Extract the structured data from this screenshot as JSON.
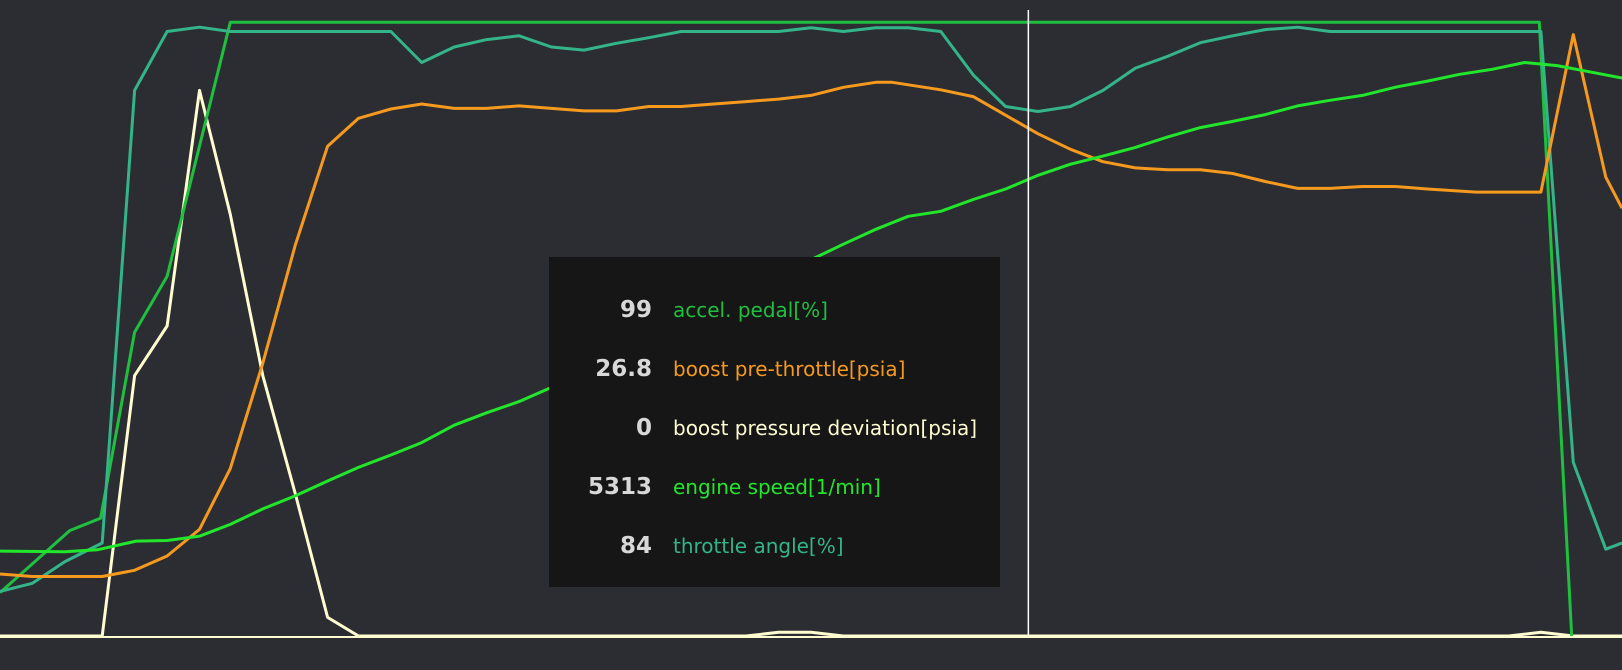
{
  "colors": {
    "background": "#2c2d32",
    "cursor": "#ffffff",
    "baseline": "#fffdd0",
    "tooltip_bg": "#161617"
  },
  "tooltip": {
    "rows": [
      {
        "value": "99",
        "label": "accel. pedal[%]",
        "color": "#1fbf3f"
      },
      {
        "value": "26.8",
        "label": "boost pre-throttle[psia]",
        "color": "#f59a1e"
      },
      {
        "value": "0",
        "label": "boost pressure deviation[psia]",
        "color": "#fffdd0"
      },
      {
        "value": "5313",
        "label": "engine speed[1/min]",
        "color": "#22e62b"
      },
      {
        "value": "84",
        "label": "throttle angle[%]",
        "color": "#34b489"
      }
    ]
  },
  "chart_data": {
    "type": "line",
    "xlim": [
      0,
      100
    ],
    "ylim": [
      0,
      100
    ],
    "cursor_x": 63.4,
    "grid": false,
    "legend": "none",
    "series": [
      {
        "name": "accel. pedal[%]",
        "color": "#1fbf3f",
        "points": [
          [
            0,
            7
          ],
          [
            4.3,
            17
          ],
          [
            6.2,
            19
          ],
          [
            8.3,
            49
          ],
          [
            10.3,
            58
          ],
          [
            14.2,
            99
          ],
          [
            94.9,
            99
          ],
          [
            96.9,
            0
          ]
        ]
      },
      {
        "name": "boost pre-throttle[psia]",
        "color": "#f59a1e",
        "points": [
          [
            0,
            10
          ],
          [
            2,
            9.6
          ],
          [
            6.3,
            9.6
          ],
          [
            8.3,
            10.6
          ],
          [
            10.3,
            12.9
          ],
          [
            12.3,
            17.2
          ],
          [
            14.2,
            27
          ],
          [
            16.2,
            44
          ],
          [
            18.2,
            63
          ],
          [
            20.2,
            79
          ],
          [
            22.1,
            83.5
          ],
          [
            24.1,
            85
          ],
          [
            26,
            85.8
          ],
          [
            28,
            85.1
          ],
          [
            30,
            85.1
          ],
          [
            32,
            85.5
          ],
          [
            34,
            85.1
          ],
          [
            36,
            84.7
          ],
          [
            38,
            84.7
          ],
          [
            40,
            85.4
          ],
          [
            42,
            85.4
          ],
          [
            44,
            85.8
          ],
          [
            46,
            86.2
          ],
          [
            48,
            86.6
          ],
          [
            50,
            87.2
          ],
          [
            52,
            88.5
          ],
          [
            54,
            89.3
          ],
          [
            55,
            89.3
          ],
          [
            57,
            88.5
          ],
          [
            58,
            88.1
          ],
          [
            60,
            87
          ],
          [
            62,
            84
          ],
          [
            64,
            81
          ],
          [
            66,
            78.5
          ],
          [
            68,
            76.5
          ],
          [
            70,
            75.5
          ],
          [
            72,
            75.2
          ],
          [
            74,
            75.2
          ],
          [
            76,
            74.6
          ],
          [
            78,
            73.3
          ],
          [
            80,
            72.2
          ],
          [
            82,
            72.2
          ],
          [
            84,
            72.5
          ],
          [
            86,
            72.5
          ],
          [
            88,
            72.1
          ],
          [
            91,
            71.6
          ],
          [
            93,
            71.6
          ],
          [
            95,
            71.6
          ],
          [
            97,
            97
          ],
          [
            99,
            74
          ],
          [
            100,
            69
          ]
        ]
      },
      {
        "name": "boost pressure deviation[psia]",
        "color": "#fffdd0",
        "points": [
          [
            0,
            0
          ],
          [
            6.3,
            0
          ],
          [
            8.3,
            42
          ],
          [
            10.3,
            50
          ],
          [
            12.3,
            88
          ],
          [
            14.2,
            68
          ],
          [
            16.2,
            42
          ],
          [
            18.2,
            23
          ],
          [
            20.2,
            3
          ],
          [
            22.1,
            0
          ],
          [
            46,
            0
          ],
          [
            48,
            0.6
          ],
          [
            50,
            0.6
          ],
          [
            52,
            0
          ],
          [
            93,
            0
          ],
          [
            95,
            0.6
          ],
          [
            97,
            0
          ],
          [
            100,
            0
          ]
        ]
      },
      {
        "name": "engine speed[1/min]",
        "color": "#22e62b",
        "points": [
          [
            0,
            13.7
          ],
          [
            4,
            13.6
          ],
          [
            6,
            13.9
          ],
          [
            8.4,
            15.3
          ],
          [
            10.3,
            15.4
          ],
          [
            12.3,
            16.1
          ],
          [
            14.2,
            18
          ],
          [
            16.2,
            20.5
          ],
          [
            18.2,
            22.6
          ],
          [
            20.2,
            25
          ],
          [
            22.1,
            27.2
          ],
          [
            24.1,
            29.2
          ],
          [
            26,
            31.2
          ],
          [
            28,
            34
          ],
          [
            30,
            36
          ],
          [
            32,
            37.8
          ],
          [
            34,
            40.1
          ],
          [
            36,
            43
          ],
          [
            38,
            45.5
          ],
          [
            40,
            48
          ],
          [
            42,
            50.5
          ],
          [
            44,
            53.1
          ],
          [
            46,
            55.6
          ],
          [
            48,
            58.2
          ],
          [
            50,
            60.7
          ],
          [
            52,
            63.2
          ],
          [
            54,
            65.6
          ],
          [
            56,
            67.7
          ],
          [
            58,
            68.5
          ],
          [
            60,
            70.4
          ],
          [
            62,
            72.1
          ],
          [
            64,
            74.3
          ],
          [
            66,
            76.1
          ],
          [
            68,
            77.4
          ],
          [
            70,
            78.8
          ],
          [
            72,
            80.5
          ],
          [
            74,
            82
          ],
          [
            76,
            83
          ],
          [
            78,
            84.1
          ],
          [
            80,
            85.5
          ],
          [
            82,
            86.4
          ],
          [
            84,
            87.2
          ],
          [
            86,
            88.5
          ],
          [
            88,
            89.5
          ],
          [
            90,
            90.6
          ],
          [
            92,
            91.4
          ],
          [
            94,
            92.5
          ],
          [
            96,
            92
          ],
          [
            98,
            91
          ],
          [
            100,
            90
          ]
        ]
      },
      {
        "name": "throttle angle[%]",
        "color": "#34b489",
        "points": [
          [
            0,
            7.2
          ],
          [
            2,
            8.5
          ],
          [
            4,
            12
          ],
          [
            6.3,
            15
          ],
          [
            8.3,
            88
          ],
          [
            10.3,
            97.5
          ],
          [
            12.3,
            98.2
          ],
          [
            14.2,
            97.5
          ],
          [
            22.1,
            97.5
          ],
          [
            24.1,
            97.5
          ],
          [
            26,
            92.5
          ],
          [
            28,
            95
          ],
          [
            30,
            96.2
          ],
          [
            32,
            96.8
          ],
          [
            34,
            95
          ],
          [
            36,
            94.5
          ],
          [
            38,
            95.6
          ],
          [
            40,
            96.5
          ],
          [
            42,
            97.5
          ],
          [
            46,
            97.5
          ],
          [
            48,
            97.5
          ],
          [
            50,
            98.1
          ],
          [
            52,
            97.5
          ],
          [
            54,
            98.1
          ],
          [
            56,
            98.1
          ],
          [
            58,
            97.5
          ],
          [
            60,
            90.5
          ],
          [
            62,
            85.4
          ],
          [
            64,
            84.6
          ],
          [
            66,
            85.4
          ],
          [
            68,
            88
          ],
          [
            70,
            91.6
          ],
          [
            72,
            93.5
          ],
          [
            74,
            95.7
          ],
          [
            76,
            96.8
          ],
          [
            78,
            97.8
          ],
          [
            80,
            98.2
          ],
          [
            82,
            97.5
          ],
          [
            86,
            97.5
          ],
          [
            90,
            97.5
          ],
          [
            95,
            97.5
          ],
          [
            97,
            28
          ],
          [
            99,
            14
          ],
          [
            100,
            15
          ]
        ]
      }
    ]
  }
}
